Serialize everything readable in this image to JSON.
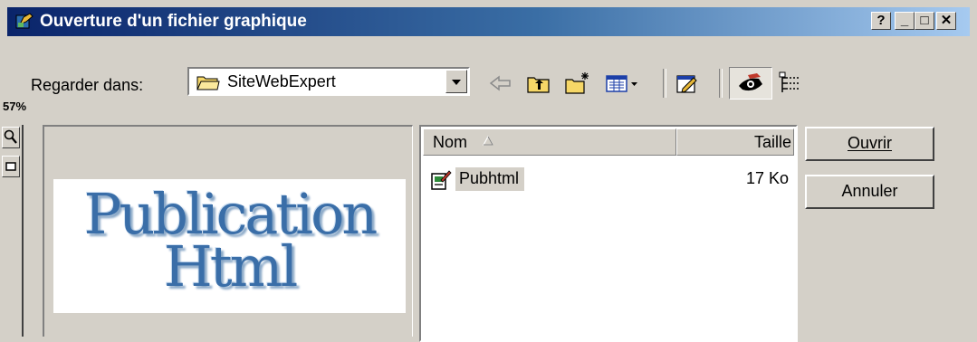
{
  "window": {
    "title": "Ouverture d'un fichier graphique",
    "help_glyph": "?",
    "minimize_glyph": "_",
    "maximize_glyph": "□",
    "close_glyph": "✕",
    "app_icon": "paint-app-icon"
  },
  "toolbar": {
    "look_in_label": "Regarder dans:",
    "look_in_access_key": "e",
    "current_folder": "SiteWebExpert",
    "folder_icon": "folder-icon",
    "buttons": [
      "back-icon",
      "up-folder-icon",
      "new-folder-icon",
      "view-menu-icon",
      "properties-icon",
      "preview-icon",
      "details-icon"
    ]
  },
  "preview": {
    "zoom_label": "57%",
    "zoom_icon": "zoom-icon",
    "fit_icon": "fit-icon",
    "image_text_line1": "Publication",
    "image_text_line2": "Html"
  },
  "file_list": {
    "columns": [
      {
        "label": "Nom",
        "sort": "ascending"
      },
      {
        "label": "Taille"
      }
    ],
    "rows": [
      {
        "name": "Pubhtml",
        "size": "17 Ko",
        "icon": "publisher-file-icon",
        "selected": true
      }
    ]
  },
  "buttons": {
    "open_label": "Ouvrir",
    "open_access_key": "O",
    "cancel_label": "Annuler",
    "cancel_access_key": "n"
  },
  "colors": {
    "title_gradient_start": "#0a246a",
    "title_gradient_end": "#a6caf0",
    "dialog_face": "#d4d0c8",
    "preview_text": "#3a6ea8"
  }
}
